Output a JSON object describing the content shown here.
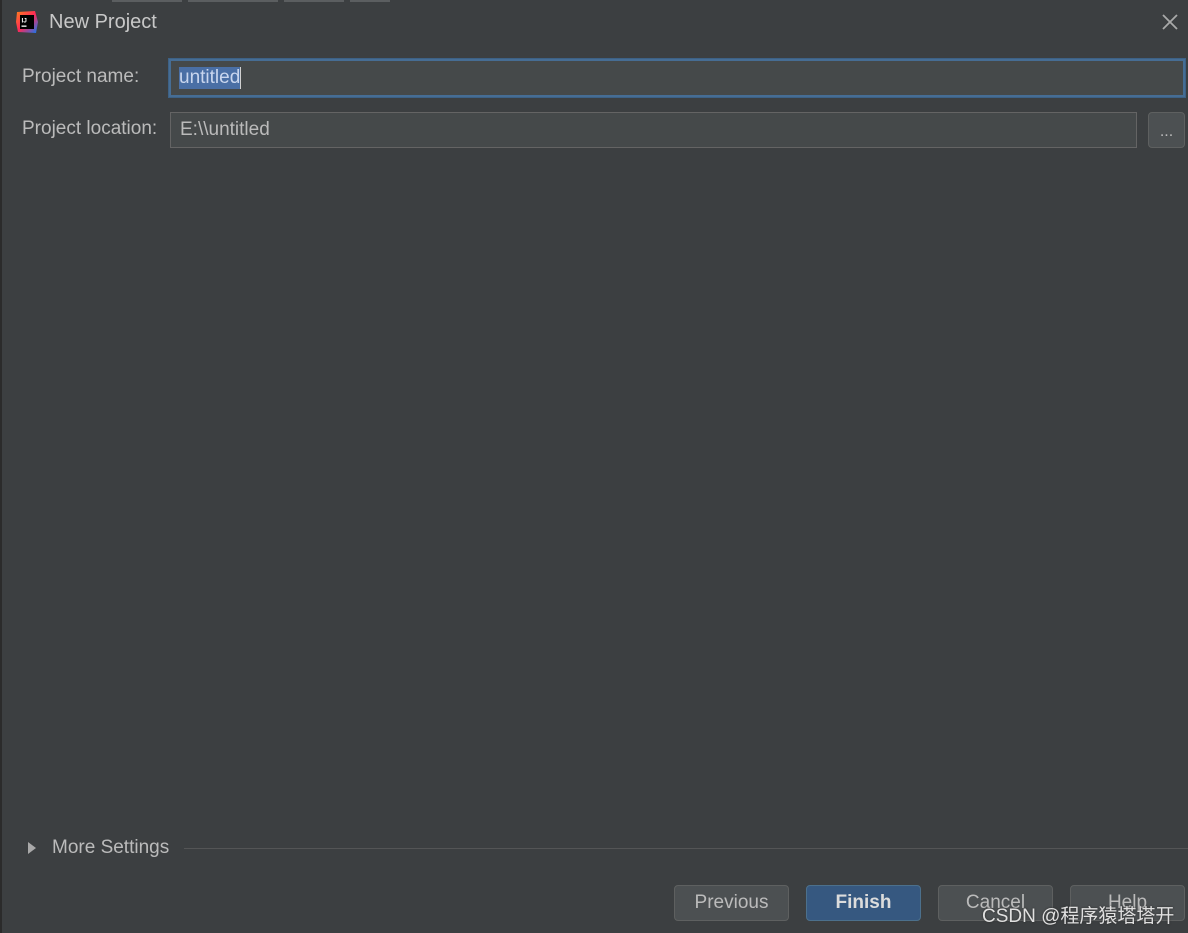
{
  "window": {
    "title": "New Project",
    "icon": "intellij-idea-icon",
    "close_icon": "close-icon"
  },
  "form": {
    "name_label": "Project name:",
    "name_value": "untitled",
    "location_label": "Project location:",
    "location_value": "E:\\\\untitled",
    "browse_label": "..."
  },
  "more_settings": {
    "label": "More Settings",
    "expanded": false
  },
  "buttons": {
    "previous": "Previous",
    "finish": "Finish",
    "cancel": "Cancel",
    "help": "Help"
  },
  "watermark": "CSDN @程序猿塔塔开",
  "colors": {
    "background": "#3c3f41",
    "field_background": "#45494a",
    "focus_border": "#466d94",
    "primary_button": "#365880",
    "selection": "#4a6fa5"
  }
}
